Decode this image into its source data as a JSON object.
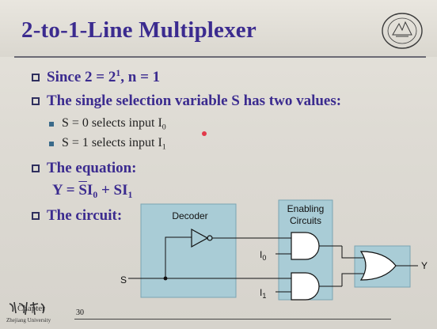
{
  "slide": {
    "title": "2-to-1-Line Multiplexer",
    "bullets": [
      {
        "pre": "Since 2 = 2",
        "sup": "1",
        "post": ", n = 1"
      },
      {
        "text": "The single selection variable S has two values:"
      },
      {
        "text": "The equation:"
      },
      {
        "text": "The circuit:"
      }
    ],
    "subbullets": [
      {
        "pre": "S = 0 selects input I",
        "sub": "0"
      },
      {
        "pre": "S = 1 selects input I",
        "sub": "1"
      }
    ],
    "equation": {
      "lhs": "Y =",
      "s_bar": "S",
      "i0": "I",
      "i0_sub": "0",
      "plus": "+ SI",
      "i1_sub": "1"
    }
  },
  "circuit": {
    "decoder_label": "Decoder",
    "enabling_label_1": "Enabling",
    "enabling_label_2": "Circuits",
    "input_s": "S",
    "input_i0": "I",
    "input_i0_sub": "0",
    "input_i1": "I",
    "input_i1_sub": "1",
    "output_y": "Y",
    "box_fill": "#a9ccd6",
    "box_stroke": "#7aa4b2"
  },
  "footer": {
    "chapter": "Chapter",
    "university": "Zhejiang University",
    "page_number": "30"
  },
  "colors": {
    "title": "#3b2b8f",
    "bullet": "#3b2b8f",
    "red_pointer": "#e23a4a"
  }
}
